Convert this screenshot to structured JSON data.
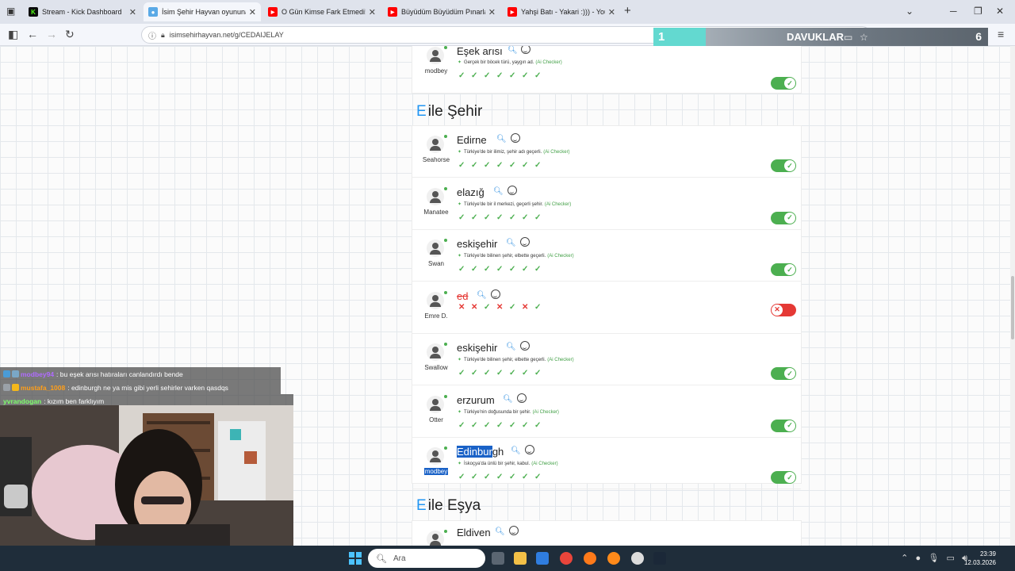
{
  "browser": {
    "tabs": [
      {
        "title": "Stream - Kick Dashboard",
        "active": false,
        "favicon": "kick-icon"
      },
      {
        "title": "İsim Şehir Hayvan oyununa katıl",
        "active": true,
        "favicon": "ish-icon"
      },
      {
        "title": "O Gün Kimse Fark Etmedi! Ela R",
        "active": false,
        "favicon": "youtube-icon"
      },
      {
        "title": "Büyüdüm Büyüdüm Pınarla Büy",
        "active": false,
        "favicon": "youtube-icon"
      },
      {
        "title": "Yahşi Batı - Yakari :))) - YouTube",
        "active": false,
        "favicon": "youtube-icon"
      }
    ],
    "url": "isimsehirhayvan.net/g/CEDAIJELAY"
  },
  "overlay_bar": {
    "left_value": "1",
    "team": "DAVUKLAR",
    "score": "6"
  },
  "top_row": {
    "player": "modbey",
    "answer": "Eşek arısı",
    "note": "Gerçek bir böcek türü, yaygın ad.",
    "checker": "(Ai Checker)",
    "votes": [
      "ok",
      "ok",
      "ok",
      "ok",
      "ok",
      "ok",
      "ok"
    ],
    "valid": true
  },
  "sections": [
    {
      "letter": "E",
      "title": "ile Şehir",
      "rows": [
        {
          "player": "Seahorse",
          "answer": "Edirne",
          "note": "Türkiye'de bir ilimiz, şehir adı geçerli.",
          "checker": "(Ai Checker)",
          "votes": [
            "ok",
            "ok",
            "ok",
            "ok",
            "ok",
            "ok",
            "ok"
          ],
          "valid": true
        },
        {
          "player": "Manatee",
          "answer": "elazığ",
          "note": "Türkiye'de bir il merkezi, geçerli şehir.",
          "checker": "(Ai Checker)",
          "votes": [
            "ok",
            "ok",
            "ok",
            "ok",
            "ok",
            "ok",
            "ok"
          ],
          "valid": true
        },
        {
          "player": "Swan",
          "answer": "eskişehir",
          "note": "Türkiye'de bilinen şehir, elbette geçerli.",
          "checker": "(Ai Checker)",
          "votes": [
            "ok",
            "ok",
            "ok",
            "ok",
            "ok",
            "ok",
            "ok"
          ],
          "valid": true
        },
        {
          "player": "Emre D.",
          "answer": "ed",
          "note": "",
          "checker": "",
          "votes": [
            "no",
            "no",
            "ok",
            "no",
            "ok",
            "no",
            "ok"
          ],
          "valid": false
        },
        {
          "player": "Swallow",
          "answer": "eskişehir",
          "note": "Türkiye'de bilinen şehir, elbette geçerli.",
          "checker": "(Ai Checker)",
          "votes": [
            "ok",
            "ok",
            "ok",
            "ok",
            "ok",
            "ok",
            "ok"
          ],
          "valid": true
        },
        {
          "player": "Otter",
          "answer": "erzurum",
          "note": "Türkiye'nin doğusunda bir şehir.",
          "checker": "(Ai Checker)",
          "votes": [
            "ok",
            "ok",
            "ok",
            "ok",
            "ok",
            "ok",
            "ok"
          ],
          "valid": true
        },
        {
          "player": "modbey",
          "answer_selected": "Edinbur",
          "answer_rest": "gh",
          "note": "İskoçya'da ünlü bir şehir, kabul.",
          "checker": "(Ai Checker)",
          "votes": [
            "ok",
            "ok",
            "ok",
            "ok",
            "ok",
            "ok",
            "ok"
          ],
          "valid": true
        }
      ]
    },
    {
      "letter": "E",
      "title": "ile Eşya",
      "rows": [
        {
          "answer": "Eldiven"
        }
      ]
    }
  ],
  "chat": [
    {
      "user": "modbey94",
      "user_color": "#b06bff",
      "message": ": bu eşek arısı hatıraları canlandırdı bende"
    },
    {
      "user": "mustafa_1008",
      "user_color": "#ff9f1a",
      "message": ": edinburgh ne ya mis gibi yerli sehirler varken qasdqs"
    },
    {
      "user": "yvrandogan",
      "user_color": "#7dff6b",
      "message": ": kızım ben farklıyım"
    }
  ],
  "taskbar": {
    "search_placeholder": "Ara",
    "time": "23:39",
    "date": "12.03.2026"
  }
}
